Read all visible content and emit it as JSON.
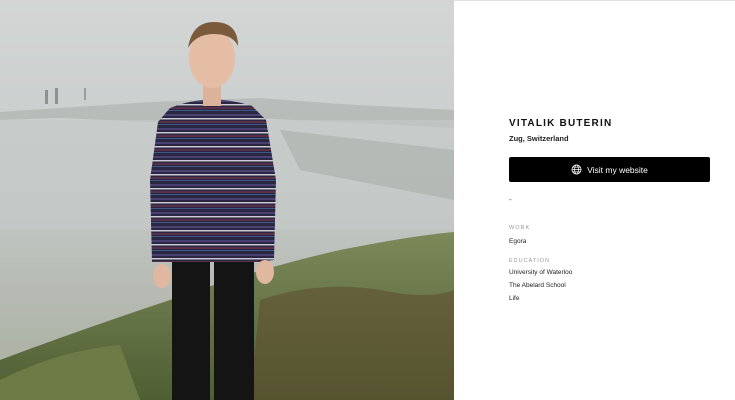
{
  "profile": {
    "name": "VITALIK BUTERIN",
    "location": "Zug, Switzerland",
    "website_button_label": "Visit my website",
    "bio_placeholder": "-",
    "work": {
      "label": "WORK",
      "items": [
        "Egora"
      ]
    },
    "education": {
      "label": "EDUCATION",
      "items": [
        "University of Waterloo",
        "The Abelard School",
        "Life"
      ]
    }
  },
  "icons": {
    "website": "globe-icon"
  },
  "colors": {
    "button_background": "#000000",
    "button_text": "#ffffff",
    "section_label": "#9a9a9a"
  }
}
